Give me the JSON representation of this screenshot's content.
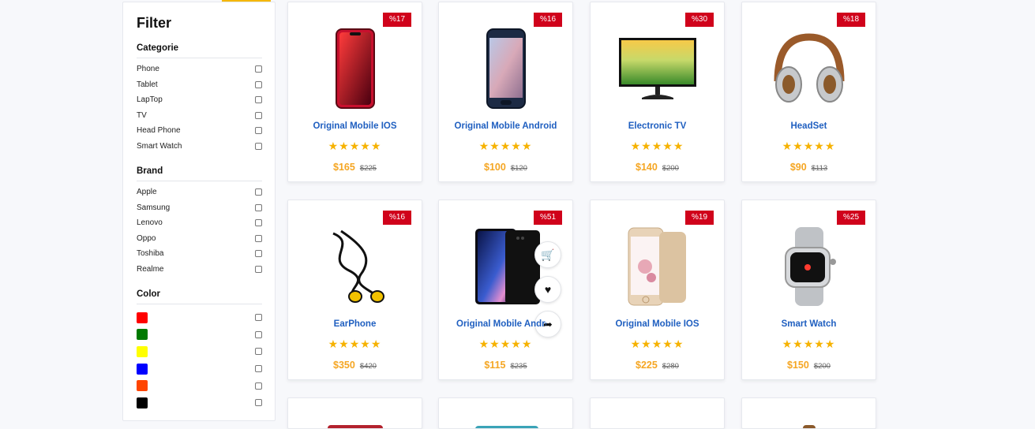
{
  "filter": {
    "title": "Filter",
    "category_title": "Categorie",
    "categories": [
      "Phone",
      "Tablet",
      "LapTop",
      "TV",
      "Head Phone",
      "Smart Watch"
    ],
    "brand_title": "Brand",
    "brands": [
      "Apple",
      "Samsung",
      "Lenovo",
      "Oppo",
      "Toshiba",
      "Realme"
    ],
    "color_title": "Color",
    "colors": [
      "#ff0000",
      "#007a00",
      "#ffff00",
      "#0000ff",
      "#ff4500",
      "#000000"
    ]
  },
  "products": [
    {
      "name": "Original Mobile IOS",
      "discount": "%17",
      "price": "$165",
      "old_price": "$225",
      "rating": 5,
      "icon": "red-iphone-image"
    },
    {
      "name": "Original Mobile Android",
      "discount": "%16",
      "price": "$100",
      "old_price": "$120",
      "rating": 5,
      "icon": "galaxy-phone-image"
    },
    {
      "name": "Electronic TV",
      "discount": "%30",
      "price": "$140",
      "old_price": "$200",
      "rating": 5,
      "icon": "monitor-image"
    },
    {
      "name": "HeadSet",
      "discount": "%18",
      "price": "$90",
      "old_price": "$113",
      "rating": 5,
      "icon": "headphones-image"
    },
    {
      "name": "EarPhone",
      "discount": "%16",
      "price": "$350",
      "old_price": "$420",
      "rating": 5,
      "icon": "earphones-image"
    },
    {
      "name": "Original Mobile Android",
      "discount": "%51",
      "price": "$115",
      "old_price": "$235",
      "rating": 5,
      "icon": "galaxy-s10-image"
    },
    {
      "name": "Original Mobile IOS",
      "discount": "%19",
      "price": "$225",
      "old_price": "$280",
      "rating": 5,
      "icon": "gold-iphone-image"
    },
    {
      "name": "Smart Watch",
      "discount": "%25",
      "price": "$150",
      "old_price": "$200",
      "rating": 5,
      "icon": "smartwatch-image"
    }
  ],
  "actions": {
    "cart_icon": "cart-icon",
    "wishlist_icon": "heart-icon",
    "share_icon": "share-icon"
  },
  "stars": "★★★★★"
}
